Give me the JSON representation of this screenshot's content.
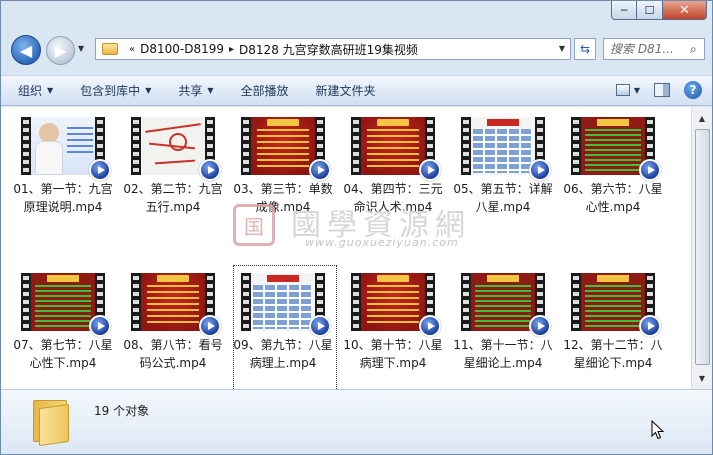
{
  "window": {
    "caption": {
      "minimize": "─",
      "maximize": "☐",
      "close": "✕"
    }
  },
  "address": {
    "prefix": "«",
    "crumbs": [
      "D8100-D8199",
      "D8128 九宫穿数高研班19集视频"
    ],
    "separator": "▸",
    "refresh_icon": "⇆"
  },
  "search": {
    "placeholder": "搜索 D81..."
  },
  "toolbar": {
    "organize": "组织",
    "include_library": "包含到库中",
    "share": "共享",
    "play_all": "全部播放",
    "new_folder": "新建文件夹"
  },
  "files": [
    {
      "name": "01、第一节：九宫原理说明.mp4",
      "art": "person"
    },
    {
      "name": "02、第二节：九宫五行.mp4",
      "art": "chalk"
    },
    {
      "name": "03、第三节：单数成像.mp4",
      "art": "red"
    },
    {
      "name": "04、第四节：三元命识人术.mp4",
      "art": "red"
    },
    {
      "name": "05、第五节：详解八星.mp4",
      "art": "table"
    },
    {
      "name": "06、第六节：八星心性.mp4",
      "art": "green"
    },
    {
      "name": "07、第七节：八星心性下.mp4",
      "art": "green"
    },
    {
      "name": "08、第八节：看号码公式.mp4",
      "art": "red"
    },
    {
      "name": "09、第九节：八星病理上.mp4",
      "art": "table",
      "selected": true
    },
    {
      "name": "10、第十节：八星病理下.mp4",
      "art": "red"
    },
    {
      "name": "11、第十一节：八星细论上.mp4",
      "art": "green"
    },
    {
      "name": "12、第十二节：八星细论下.mp4",
      "art": "green"
    }
  ],
  "watermark": {
    "seal": "国",
    "title": "國學資源網",
    "url": "www.guoxueziyuan.com"
  },
  "details": {
    "count": "19 个对象"
  }
}
